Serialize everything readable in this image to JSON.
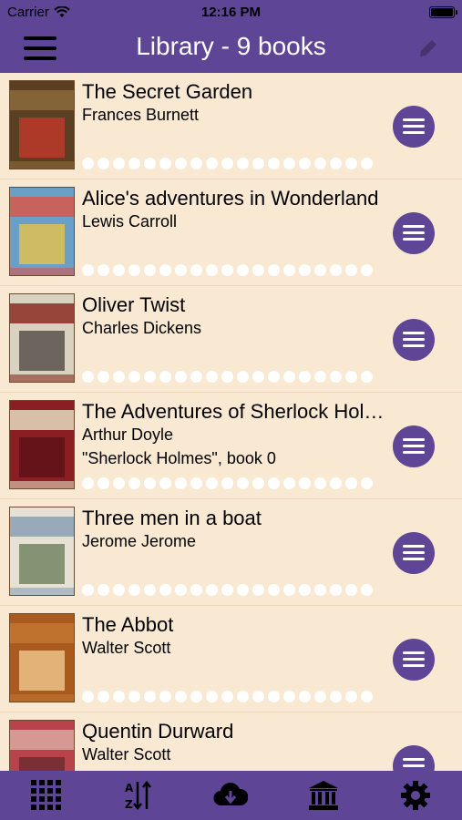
{
  "status_bar": {
    "carrier": "Carrier",
    "time": "12:16 PM"
  },
  "nav": {
    "title": "Library - 9 books"
  },
  "books": [
    {
      "title": "The Secret Garden",
      "author": "Frances Burnett",
      "series": "",
      "cover_colors": [
        "#5a3f22",
        "#8c6a3c",
        "#c23a2a"
      ]
    },
    {
      "title": "Alice's adventures in Wonderland",
      "author": "Lewis Carroll",
      "series": "",
      "cover_colors": [
        "#6a9fc8",
        "#d8574a",
        "#e8c24a"
      ]
    },
    {
      "title": "Oliver Twist",
      "author": "Charles Dickens",
      "series": "",
      "cover_colors": [
        "#d9d2c1",
        "#8b2c22",
        "#4f4a44"
      ]
    },
    {
      "title": "The Adventures of Sherlock Holmes",
      "author": "Arthur Doyle",
      "series": "\"Sherlock Holmes\", book 0",
      "cover_colors": [
        "#8a1e22",
        "#e8dcc0",
        "#5a1216"
      ]
    },
    {
      "title": "Three men in a boat",
      "author": "Jerome Jerome",
      "series": "",
      "cover_colors": [
        "#e6e1d4",
        "#8aa0b5",
        "#6b7f5a"
      ]
    },
    {
      "title": "The Abbot",
      "author": "Walter Scott",
      "series": "",
      "cover_colors": [
        "#a85a1f",
        "#c37730",
        "#f0c890"
      ]
    },
    {
      "title": "Quentin Durward",
      "author": "Walter Scott",
      "series": "",
      "cover_colors": [
        "#b9434a",
        "#d8a8a0",
        "#6a2a30"
      ]
    }
  ],
  "progress_dots": 19,
  "tabbar": {
    "tabs": [
      {
        "icon": "grid-icon"
      },
      {
        "icon": "sort-az-icon"
      },
      {
        "icon": "cloud-download-icon"
      },
      {
        "icon": "library-icon"
      },
      {
        "icon": "gear-icon"
      }
    ]
  },
  "colors": {
    "accent": "#5e4595",
    "background": "#f9e9d3",
    "separator": "#ecd6b8"
  }
}
